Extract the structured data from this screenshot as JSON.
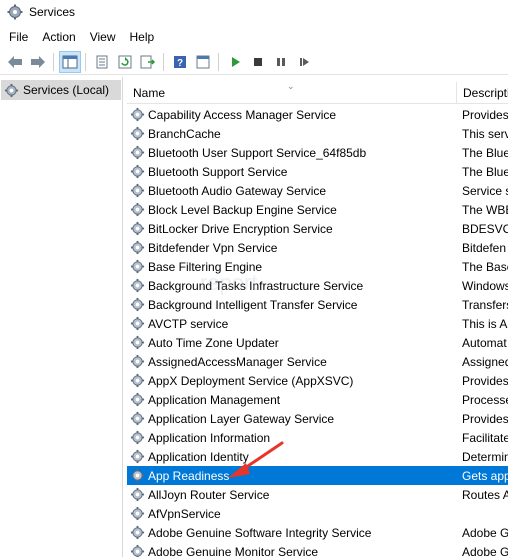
{
  "window": {
    "title": "Services"
  },
  "menu": {
    "items": [
      "File",
      "Action",
      "View",
      "Help"
    ]
  },
  "toolbar": {
    "buttons": [
      "back-icon",
      "forward-icon",
      "show-hide-console-tree-icon",
      "properties-icon",
      "refresh-icon",
      "export-list-icon",
      "help-icon",
      "console-icon",
      "start-service-icon",
      "stop-service-icon",
      "pause-service-icon",
      "restart-service-icon"
    ]
  },
  "tree": {
    "root_label": "Services (Local)"
  },
  "table": {
    "columns": {
      "name": "Name",
      "description": "Descripti"
    },
    "rows": [
      {
        "name": "Capability Access Manager Service",
        "description": "Provides"
      },
      {
        "name": "BranchCache",
        "description": "This serv"
      },
      {
        "name": "Bluetooth User Support Service_64f85db",
        "description": "The Blue"
      },
      {
        "name": "Bluetooth Support Service",
        "description": "The Blue"
      },
      {
        "name": "Bluetooth Audio Gateway Service",
        "description": "Service s"
      },
      {
        "name": "Block Level Backup Engine Service",
        "description": "The WBE"
      },
      {
        "name": "BitLocker Drive Encryption Service",
        "description": "BDESVC"
      },
      {
        "name": "Bitdefender Vpn Service",
        "description": "Bitdefen"
      },
      {
        "name": "Base Filtering Engine",
        "description": "The Base"
      },
      {
        "name": "Background Tasks Infrastructure Service",
        "description": "Windows"
      },
      {
        "name": "Background Intelligent Transfer Service",
        "description": "Transfers"
      },
      {
        "name": "AVCTP service",
        "description": "This is A"
      },
      {
        "name": "Auto Time Zone Updater",
        "description": "Automat"
      },
      {
        "name": "AssignedAccessManager Service",
        "description": "Assigned"
      },
      {
        "name": "AppX Deployment Service (AppXSVC)",
        "description": "Provides"
      },
      {
        "name": "Application Management",
        "description": "Processe"
      },
      {
        "name": "Application Layer Gateway Service",
        "description": "Provides"
      },
      {
        "name": "Application Information",
        "description": "Facilitate"
      },
      {
        "name": "Application Identity",
        "description": "Determin"
      },
      {
        "name": "App Readiness",
        "description": "Gets app",
        "selected": true
      },
      {
        "name": "AllJoyn Router Service",
        "description": "Routes A"
      },
      {
        "name": "AfVpnService",
        "description": ""
      },
      {
        "name": "Adobe Genuine Software Integrity Service",
        "description": "Adobe G"
      },
      {
        "name": "Adobe Genuine Monitor Service",
        "description": "Adobe G"
      }
    ]
  },
  "colors": {
    "selection": "#0078d7",
    "annotation_arrow": "#e8352a"
  }
}
